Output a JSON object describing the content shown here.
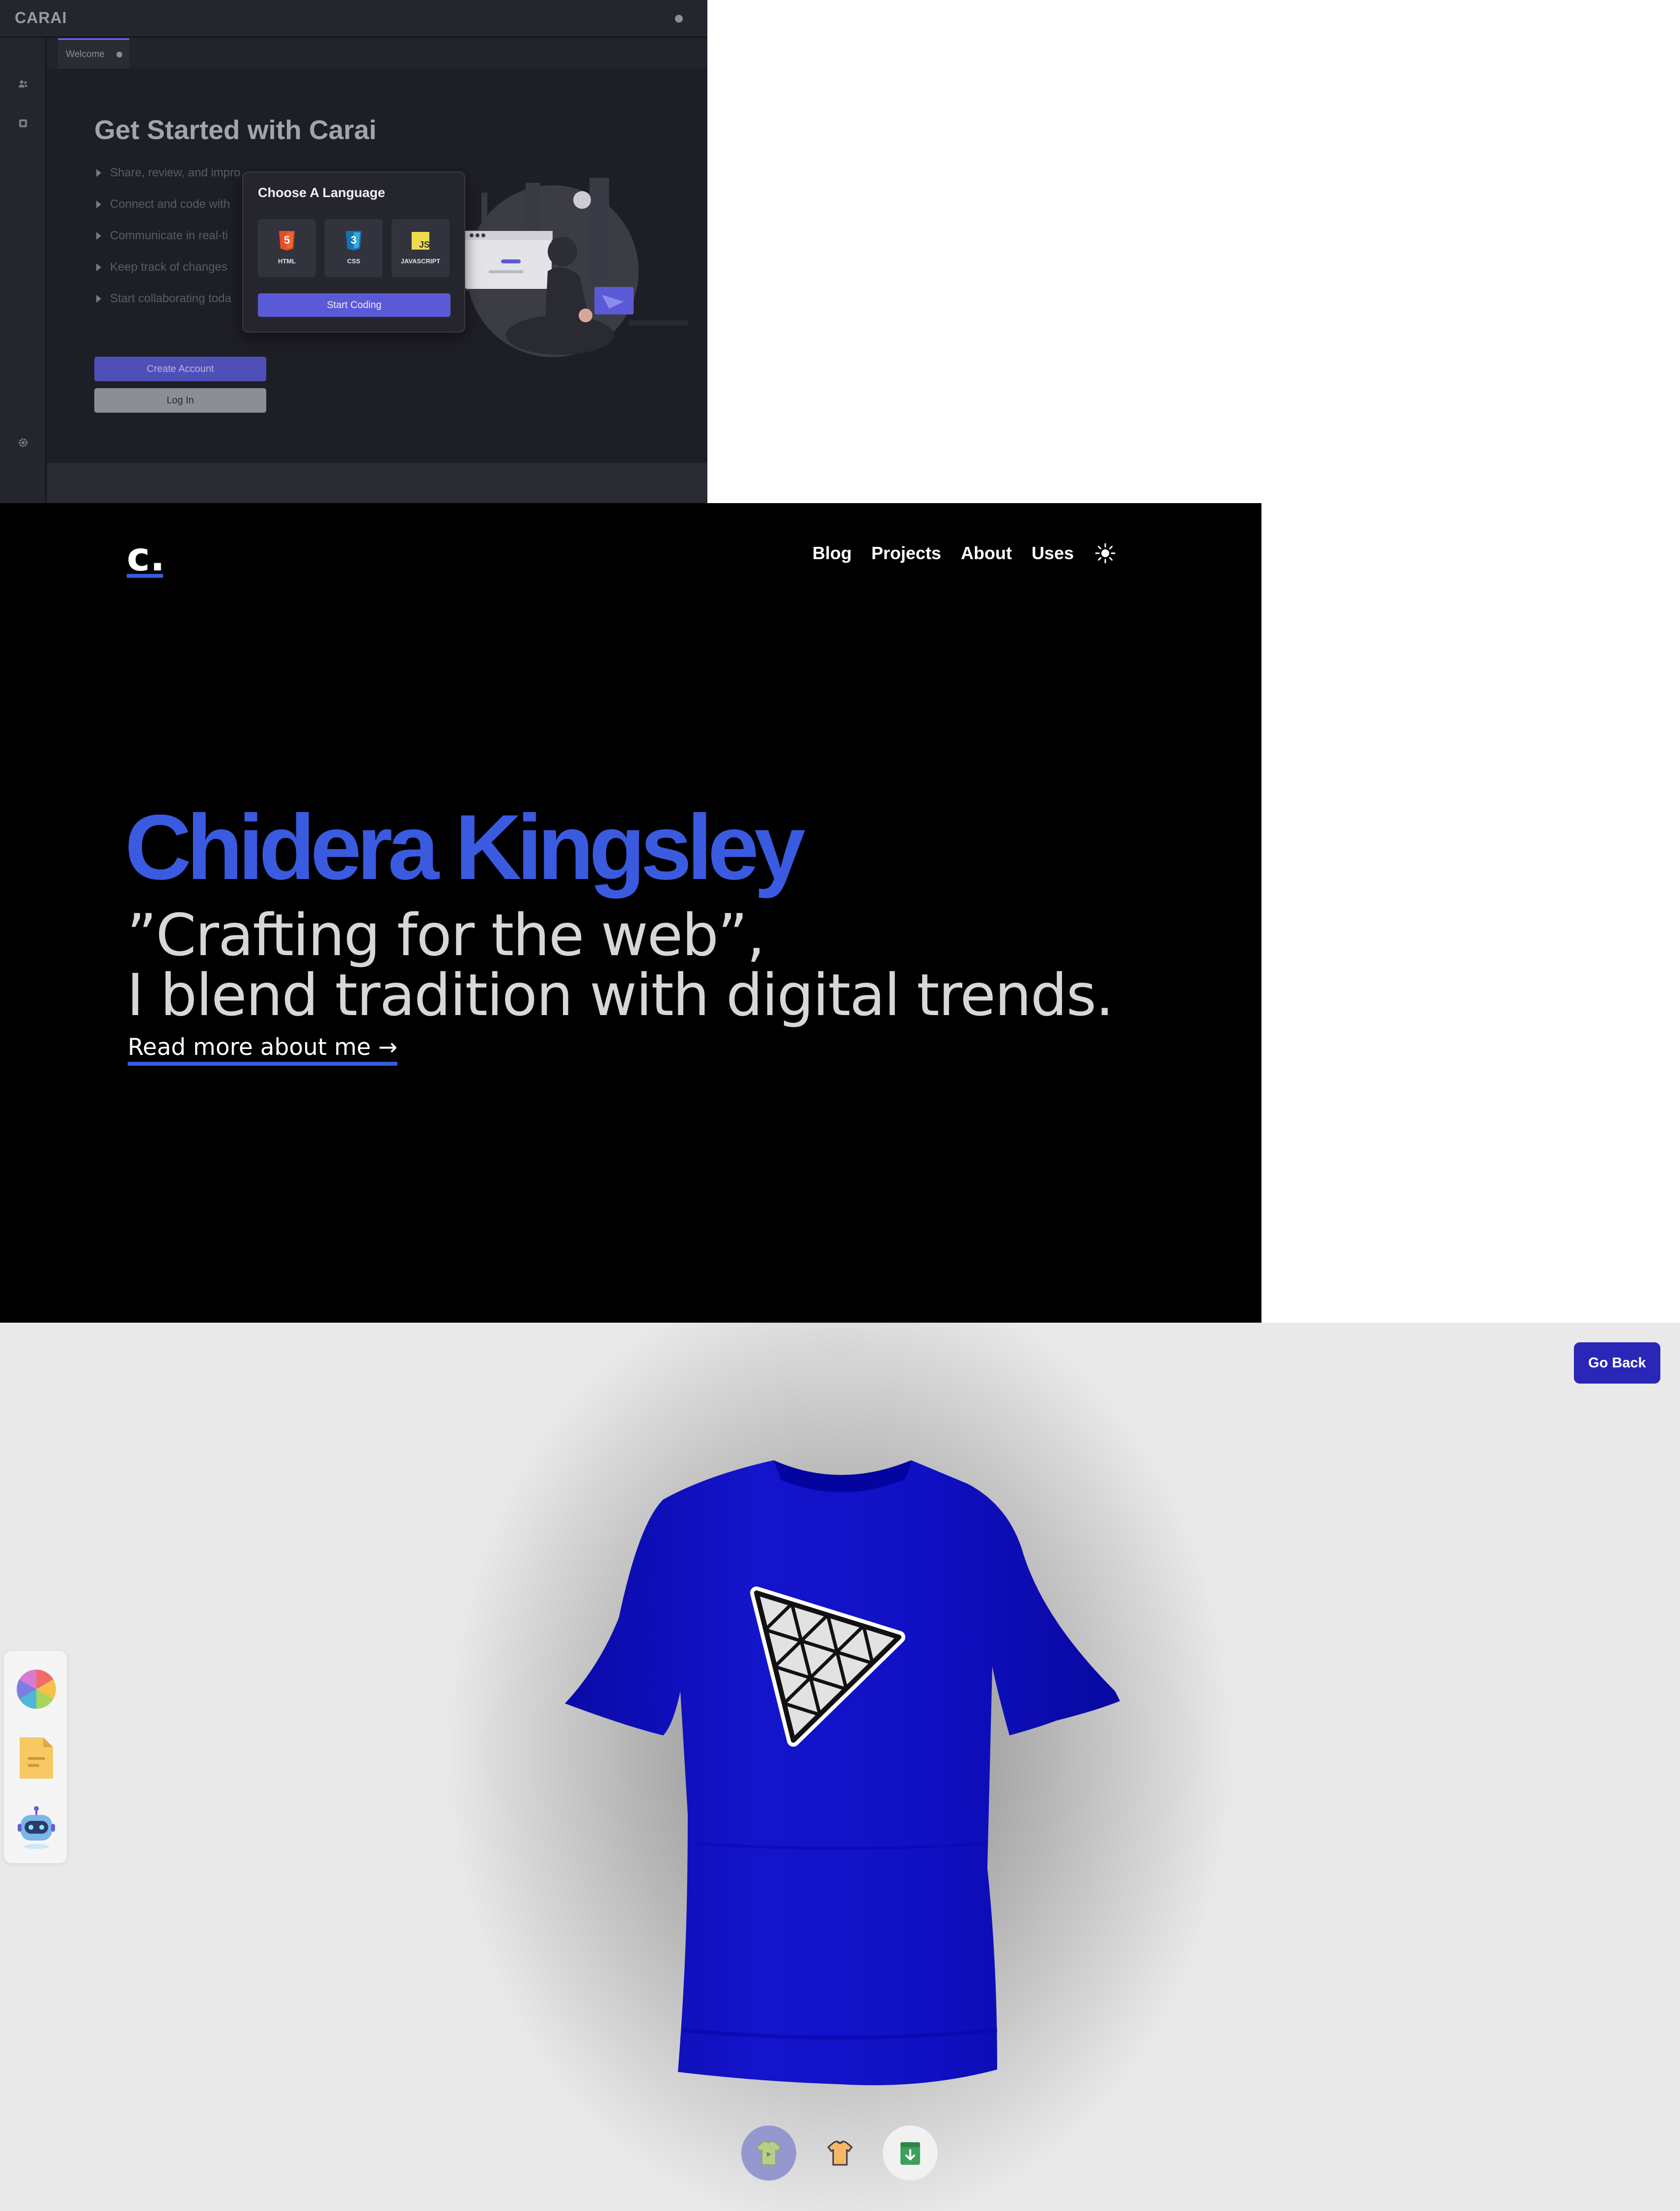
{
  "carai": {
    "app_name": "CARAI",
    "tab_label": "Welcome",
    "title": "Get Started with Carai",
    "steps": [
      "Share, review, and impro",
      "Connect and code with",
      "Communicate in real-ti",
      "Keep track of changes",
      "Start collaborating toda"
    ],
    "create_account": "Create Account",
    "log_in": "Log In",
    "dialog": {
      "title": "Choose A Language",
      "languages": [
        "HTML",
        "CSS",
        "JAVASCRIPT"
      ],
      "start_button": "Start Coding"
    },
    "colors": {
      "accent": "#5a5ad6",
      "background": "#1e1e26"
    }
  },
  "portfolio": {
    "logo": "c.",
    "nav": [
      "Blog",
      "Projects",
      "About",
      "Uses"
    ],
    "theme_icon": "sun-icon",
    "name": "Chidera Kingsley",
    "tagline_line1": "”Crafting for the web”,",
    "tagline_line2": "I blend tradition with digital trends.",
    "read_more": "Read more about me →",
    "colors": {
      "accent": "#3a5be0",
      "background": "#000000"
    }
  },
  "customizer": {
    "go_back": "Go Back",
    "shirt_color": "#1010c8",
    "tools": [
      "color-picker-icon",
      "file-picker-icon",
      "ai-picker-icon"
    ],
    "filters": [
      "logo-shirt-icon",
      "stylish-shirt-icon",
      "download-icon"
    ]
  }
}
